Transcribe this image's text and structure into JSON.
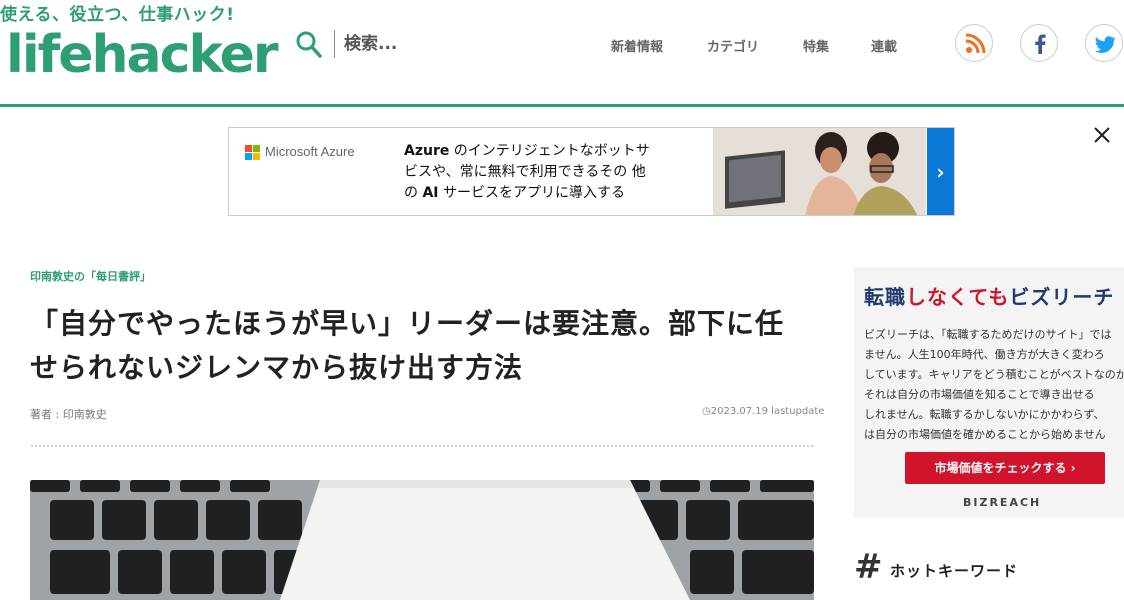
{
  "header": {
    "tagline": "使える、役立つ、仕事ハック!",
    "logo_text": "lifehacker",
    "search_placeholder": "検索...",
    "nav": [
      "新着情報",
      "カテゴリ",
      "特集",
      "連載"
    ],
    "social_icons": [
      "rss-icon",
      "facebook-icon",
      "twitter-icon"
    ],
    "accent_color": "#2e9e73"
  },
  "ad_banner": {
    "brand": "Microsoft Azure",
    "text_line1_bold": "Azure",
    "text_line1": " のインテリジェントなボットサ",
    "text_line2": "ビスや、常に無料で利用できるその 他",
    "text_line3_prefix": "の ",
    "text_line3_bold": "AI",
    "text_line3": " サービスをアプリに導入する",
    "arrow": "›"
  },
  "article": {
    "category": "印南敦史の「毎日書評」",
    "title": "「自分でやったほうが早い」リーダーは要注意。部下に任せられないジレンマから抜け出す方法",
    "author": "著者 : 印南敦史",
    "date": "2023.07.19 lastupdate"
  },
  "sidebar_ad": {
    "headline_a": "転職",
    "headline_b": "しなくても",
    "headline_c": "ビズリーチ",
    "body": [
      "ビズリーチは、「転職するためだけのサイト」では",
      "ません。人生100年時代、働き方が大きく変わろ",
      "しています。キャリアをどう積むことがベストなのか",
      "それは自分の市場価値を知ることで導き出せる",
      "しれません。転職するかしないかにかかわらず、",
      "は自分の市場価値を確かめることから始めません"
    ],
    "button": "市場価値をチェックする ›",
    "brand": "BIZREACH"
  },
  "hot_keywords": {
    "symbol": "#",
    "title": "ホットキーワード"
  }
}
